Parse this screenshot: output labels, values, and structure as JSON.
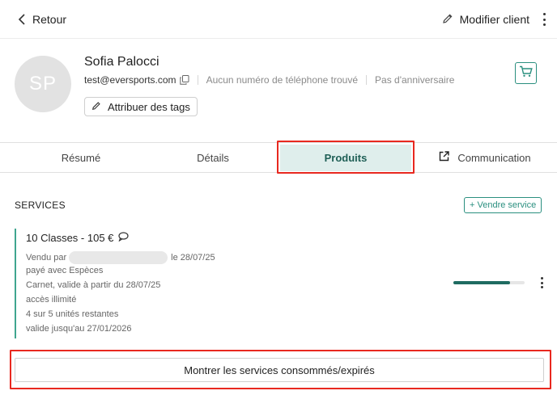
{
  "topbar": {
    "back_label": "Retour",
    "edit_label": "Modifier client",
    "icons": [
      "chevron-left-icon",
      "pencil-icon",
      "more-vertical-icon"
    ]
  },
  "customer": {
    "initials": "SP",
    "name": "Sofia Palocci",
    "email": "test@eversports.com",
    "phone_text": "Aucun numéro de téléphone trouvé",
    "birthday_text": "Pas d'anniversaire",
    "tags_button": "Attribuer des tags"
  },
  "tabs": [
    {
      "label": "Résumé",
      "active": false
    },
    {
      "label": "Détails",
      "active": false
    },
    {
      "label": "Produits",
      "active": true
    },
    {
      "label": "Communication",
      "active": false,
      "icon": "external-link-icon"
    }
  ],
  "services": {
    "title": "SERVICES",
    "sell_button": "+ Vendre service",
    "items": [
      {
        "title": "10 Classes - 105 €",
        "sold_by_prefix": "Vendu par",
        "sold_on": "le 28/07/25",
        "payment": "payé avec Espèces",
        "validity_start": "Carnet, valide à partir du 28/07/25",
        "access": "accès illimité",
        "units": "4 sur 5 unités restantes",
        "valid_until": "valide jusqu'au 27/01/2026",
        "progress_fraction": 0.8
      }
    ],
    "show_consumed_button": "Montrer les services consommés/expirés"
  },
  "colors": {
    "accent": "#2a8f7f",
    "active_tab_bg": "#dfeeec",
    "highlight": "#e8281f",
    "progress_fill": "#1f6b61"
  }
}
